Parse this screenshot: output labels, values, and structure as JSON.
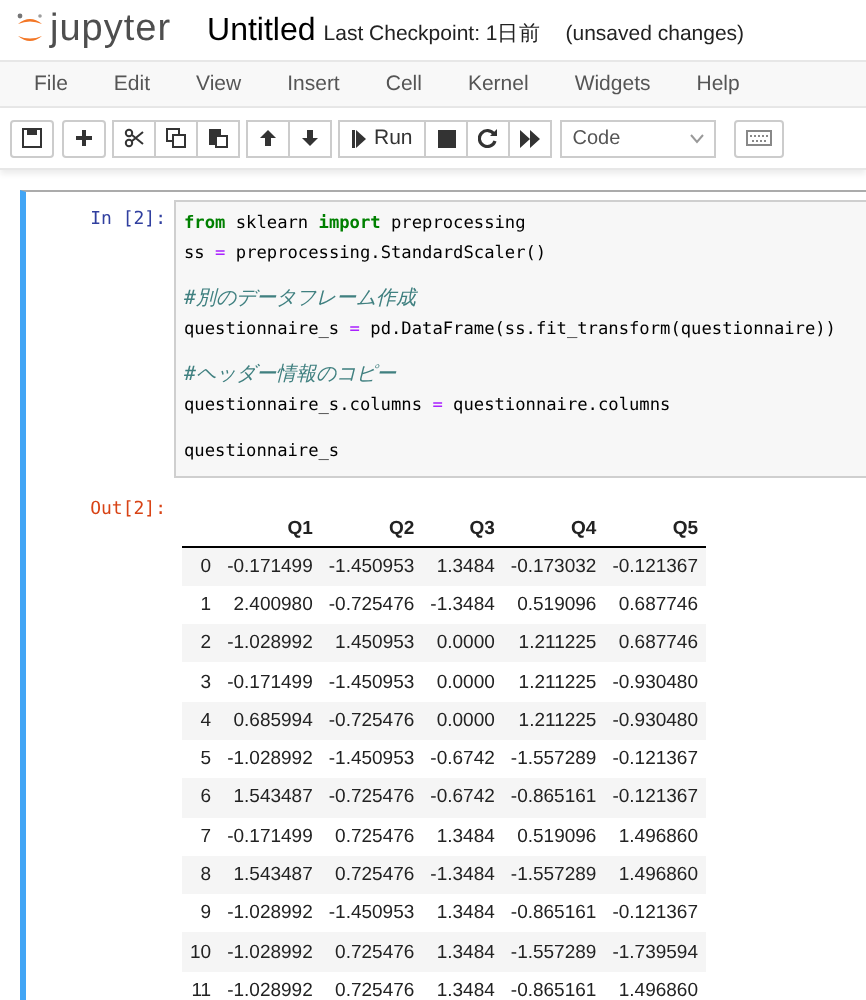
{
  "header": {
    "logo_text": "jupyter",
    "notebook_title": "Untitled",
    "checkpoint": "Last Checkpoint: 1日前",
    "save_status": "(unsaved changes)"
  },
  "menu": [
    "File",
    "Edit",
    "View",
    "Insert",
    "Cell",
    "Kernel",
    "Widgets",
    "Help"
  ],
  "toolbar": {
    "run_label": "Run",
    "cell_type": "Code"
  },
  "cell": {
    "selected": true,
    "prompt": "In [2]:",
    "lines": [
      {
        "kind": "code",
        "tokens": [
          {
            "kind": "keyword",
            "text": "from"
          },
          {
            "kind": "plain",
            "text": " sklearn "
          },
          {
            "kind": "keyword",
            "text": "import"
          },
          {
            "kind": "plain",
            "text": " preprocessing"
          }
        ]
      },
      {
        "kind": "code",
        "tokens": [
          {
            "kind": "plain",
            "text": "ss "
          },
          {
            "kind": "operator",
            "text": "="
          },
          {
            "kind": "plain",
            "text": " preprocessing.StandardScaler()"
          }
        ]
      },
      {
        "kind": "blank"
      },
      {
        "kind": "code",
        "tokens": [
          {
            "kind": "comment",
            "text": "#別のデータフレーム作成"
          }
        ]
      },
      {
        "kind": "code",
        "tokens": [
          {
            "kind": "plain",
            "text": "questionnaire_s "
          },
          {
            "kind": "operator",
            "text": "="
          },
          {
            "kind": "plain",
            "text": " pd.DataFrame(ss.fit_transform(questionnaire))"
          }
        ]
      },
      {
        "kind": "blank"
      },
      {
        "kind": "code",
        "tokens": [
          {
            "kind": "comment",
            "text": "#ヘッダー情報のコピー"
          }
        ]
      },
      {
        "kind": "code",
        "tokens": [
          {
            "kind": "plain",
            "text": "questionnaire_s.columns "
          },
          {
            "kind": "operator",
            "text": "="
          },
          {
            "kind": "plain",
            "text": " questionnaire.columns"
          }
        ]
      },
      {
        "kind": "blank"
      },
      {
        "kind": "code",
        "tokens": [
          {
            "kind": "plain",
            "text": "questionnaire_s"
          }
        ]
      }
    ],
    "output_prompt": "Out[2]:",
    "table": {
      "columns": [
        "Q1",
        "Q2",
        "Q3",
        "Q4",
        "Q5"
      ],
      "rows": [
        {
          "index": "0",
          "values": [
            "-0.171499",
            "-1.450953",
            "1.3484",
            "-0.173032",
            "-0.121367"
          ]
        },
        {
          "index": "1",
          "values": [
            "2.400980",
            "-0.725476",
            "-1.3484",
            "0.519096",
            "0.687746"
          ]
        },
        {
          "index": "2",
          "values": [
            "-1.028992",
            "1.450953",
            "0.0000",
            "1.211225",
            "0.687746"
          ]
        },
        {
          "index": "3",
          "values": [
            "-0.171499",
            "-1.450953",
            "0.0000",
            "1.211225",
            "-0.930480"
          ]
        },
        {
          "index": "4",
          "values": [
            "0.685994",
            "-0.725476",
            "0.0000",
            "1.211225",
            "-0.930480"
          ]
        },
        {
          "index": "5",
          "values": [
            "-1.028992",
            "-1.450953",
            "-0.6742",
            "-1.557289",
            "-0.121367"
          ]
        },
        {
          "index": "6",
          "values": [
            "1.543487",
            "-0.725476",
            "-0.6742",
            "-0.865161",
            "-0.121367"
          ]
        },
        {
          "index": "7",
          "values": [
            "-0.171499",
            "0.725476",
            "1.3484",
            "0.519096",
            "1.496860"
          ]
        },
        {
          "index": "8",
          "values": [
            "1.543487",
            "0.725476",
            "-1.3484",
            "-1.557289",
            "1.496860"
          ]
        },
        {
          "index": "9",
          "values": [
            "-1.028992",
            "-1.450953",
            "1.3484",
            "-0.865161",
            "-0.121367"
          ]
        },
        {
          "index": "10",
          "values": [
            "-1.028992",
            "0.725476",
            "1.3484",
            "-1.557289",
            "-1.739594"
          ]
        },
        {
          "index": "11",
          "values": [
            "-1.028992",
            "0.725476",
            "1.3484",
            "-0.865161",
            "1.496860"
          ]
        }
      ]
    }
  }
}
